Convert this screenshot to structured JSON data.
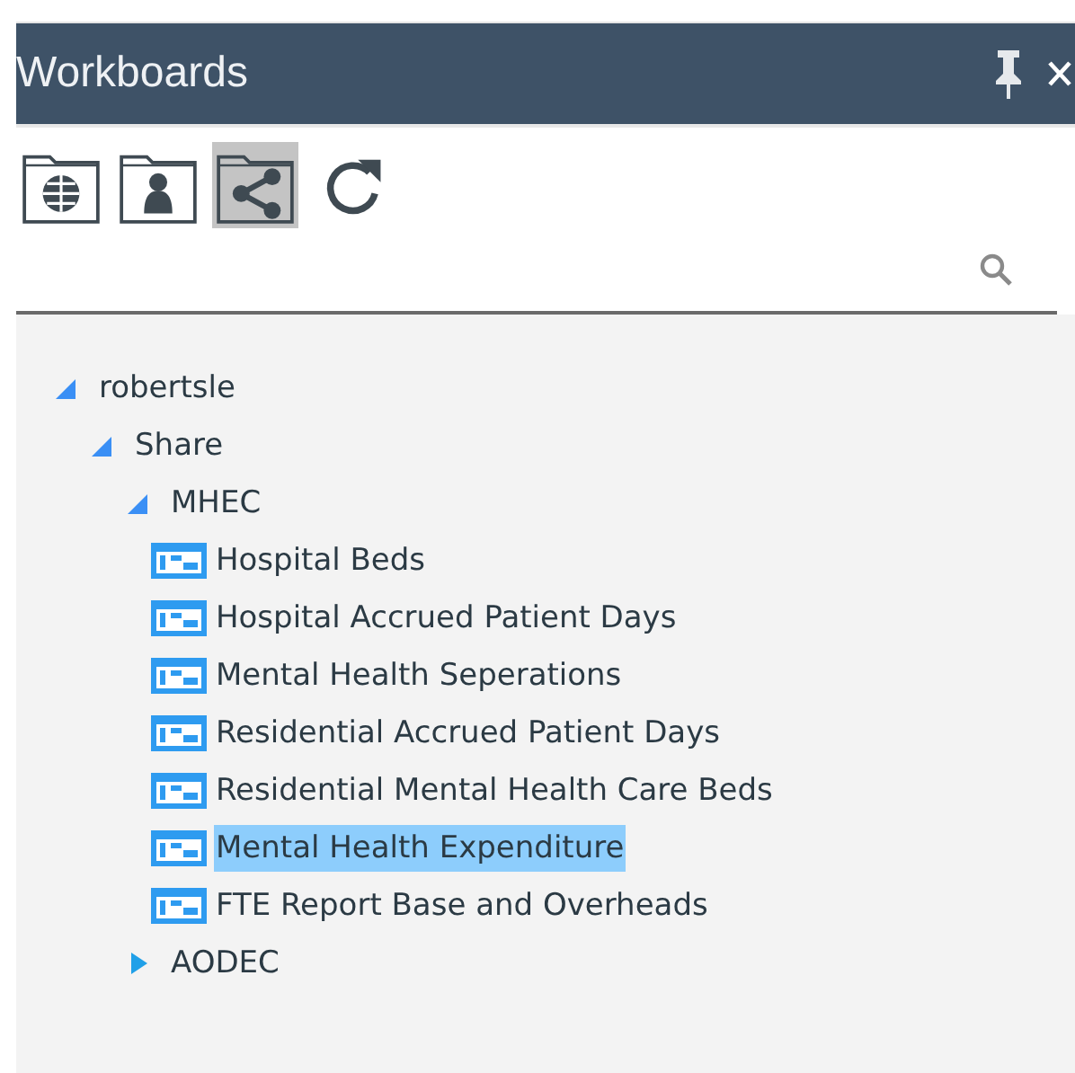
{
  "panel": {
    "title": "Workboards"
  },
  "toolbar": [
    {
      "kind": "globe-folder",
      "selected": false
    },
    {
      "kind": "person-folder",
      "selected": false
    },
    {
      "kind": "share-folder",
      "selected": true
    },
    {
      "kind": "refresh",
      "selected": false
    }
  ],
  "tree": [
    {
      "label": "robertsle",
      "kind": "folder",
      "expanded": true,
      "children": [
        {
          "label": "Share",
          "kind": "folder",
          "expanded": true,
          "children": [
            {
              "label": "MHEC",
              "kind": "folder",
              "expanded": true,
              "children": [
                {
                  "label": "Hospital Beds",
                  "kind": "workboard",
                  "selected": false
                },
                {
                  "label": "Hospital Accrued Patient Days",
                  "kind": "workboard",
                  "selected": false
                },
                {
                  "label": "Mental Health Seperations",
                  "kind": "workboard",
                  "selected": false
                },
                {
                  "label": "Residential Accrued Patient Days",
                  "kind": "workboard",
                  "selected": false
                },
                {
                  "label": "Residential Mental Health Care Beds",
                  "kind": "workboard",
                  "selected": false
                },
                {
                  "label": "Mental Health Expenditure",
                  "kind": "workboard",
                  "selected": true
                },
                {
                  "label": "FTE Report Base and Overheads",
                  "kind": "workboard",
                  "selected": false
                }
              ]
            },
            {
              "label": "AODEC",
              "kind": "folder",
              "expanded": false
            }
          ]
        }
      ]
    }
  ]
}
